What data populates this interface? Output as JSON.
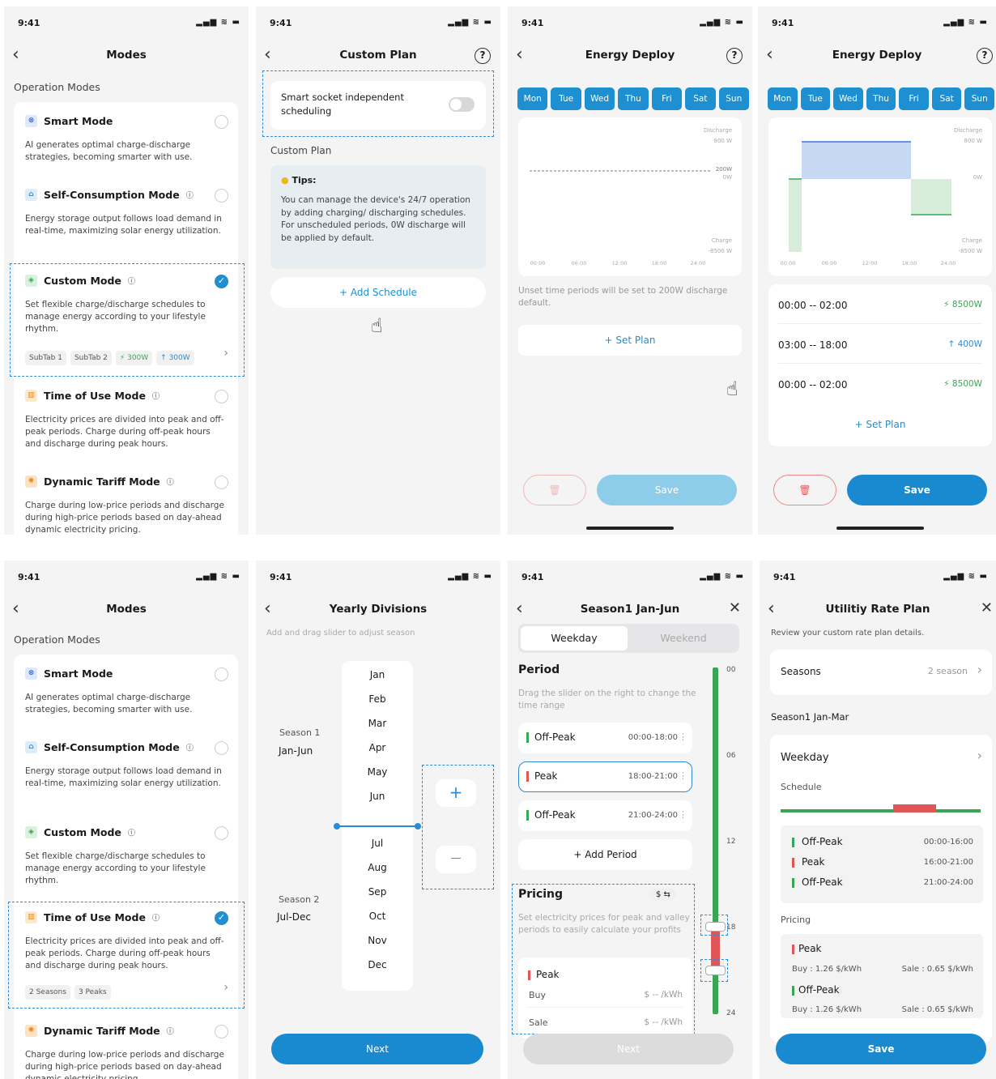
{
  "status": {
    "time": "9:41",
    "icons": "▂▄▆ ≋ ▬"
  },
  "icons": {
    "back": "‹",
    "close": "✕",
    "help": "?",
    "check": "✓",
    "bolt": "⚡",
    "up": "↑",
    "trash": "🗑",
    "hand": "☝",
    "plus": "+",
    "minus": "—",
    "more": "⋮",
    "chev": "›",
    "swap": "$ ⇆"
  },
  "colors": {
    "accent": "#1e8fd0",
    "green": "#3aa655",
    "red": "#e05656"
  },
  "modes": {
    "title": "Modes",
    "section": "Operation Modes",
    "smart": {
      "name": "Smart Mode",
      "desc": "AI generates optimal charge-discharge strategies, becoming smarter with use."
    },
    "self": {
      "name": "Self-Consumption Mode",
      "desc": "Energy storage output follows load demand in real-time, maximizing solar energy utilization."
    },
    "custom": {
      "name": "Custom Mode",
      "desc": "Set flexible charge/discharge schedules to manage energy according to your lifestyle rhythm.",
      "chips": [
        "SubTab 1",
        "SubTab 2",
        "⚡ 300W",
        "↑ 300W"
      ]
    },
    "tou": {
      "name": "Time of Use Mode",
      "desc": "Electricity prices are divided into peak and off-peak periods. Charge during off-peak hours and discharge during peak hours.",
      "chips": [
        "2 Seasons",
        "3 Peaks"
      ]
    },
    "dyn": {
      "name": "Dynamic Tariff Mode",
      "desc": "Charge during low-price periods and discharge during high-price periods based on day-ahead dynamic electricity pricing.",
      "desc2": "Charge during low-price periods and discharge during high-price periods based on day-ahead dynamic electricity pricing."
    }
  },
  "custom_plan": {
    "title": "Custom Plan",
    "toggle_label": "Smart socket independent scheduling",
    "section": "Custom Plan",
    "tips_title": "Tips:",
    "tips": "You can manage the device's 24/7 operation by adding charging/ discharging schedules. For unscheduled periods, 0W discharge will be applied by default.",
    "add": "+ Add Schedule"
  },
  "energy": {
    "title": "Energy Deploy",
    "days": [
      "Mon",
      "Tue",
      "Wed",
      "Thu",
      "Fri",
      "Sat",
      "Sun"
    ],
    "y_top": "Discharge",
    "y_top_val": "800 W",
    "y_mid": "200W",
    "y_zero": "0W",
    "y_bot": "Charge",
    "y_bot_val": "-8500 W",
    "xticks": [
      "00:00",
      "06:00",
      "12:00",
      "18:00",
      "24:00"
    ],
    "note": "Unset time periods will be set to 200W discharge default.",
    "set_plan": "+ Set Plan",
    "save": "Save",
    "plans": [
      {
        "range": "00:00 -- 02:00",
        "val": "⚡ 8500W"
      },
      {
        "range": "03:00 -- 18:00",
        "val": "↑ 400W"
      },
      {
        "range": "00:00 -- 02:00",
        "val": "⚡ 8500W"
      }
    ]
  },
  "chart_data": {
    "type": "area",
    "x": [
      "00:00",
      "06:00",
      "12:00",
      "18:00",
      "24:00"
    ],
    "series": [
      {
        "values": [
          -8500,
          800,
          800,
          -3000,
          0
        ]
      }
    ],
    "ylim": [
      -8500,
      800
    ]
  },
  "yearly": {
    "title": "Yearly Divisions",
    "hint": "Add and drag slider to adjust season",
    "months": [
      "Jan",
      "Feb",
      "Mar",
      "Apr",
      "May",
      "Jun",
      "Jul",
      "Aug",
      "Sep",
      "Oct",
      "Nov",
      "Dec"
    ],
    "s1": "Season 1",
    "s1r": "Jan-Jun",
    "s2": "Season 2",
    "s2r": "Jul-Dec",
    "next": "Next"
  },
  "season": {
    "title": "Season1 Jan-Jun",
    "tabs": [
      "Weekday",
      "Weekend"
    ],
    "period": "Period",
    "period_hint": "Drag the slider on the right to change the time range",
    "rows": [
      {
        "name": "Off-Peak",
        "time": "00:00-18:00"
      },
      {
        "name": "Peak",
        "time": "18:00-21:00"
      },
      {
        "name": "Off-Peak",
        "time": "21:00-24:00"
      }
    ],
    "add": "+ Add Period",
    "pricing": "Pricing",
    "price_hint": "Set electricity prices for peak and valley periods to easily calculate your profits",
    "peak": "Peak",
    "buy": "Buy",
    "sale": "Sale",
    "unit": "$ -- /kWh",
    "ticks": [
      "00",
      "06",
      "12",
      "18",
      "24"
    ],
    "next": "Next"
  },
  "utility": {
    "title": "Utilitiy Rate Plan",
    "hint": "Review your custom rate plan details.",
    "seasons": "Seasons",
    "seasons_val": "2 season",
    "sub": "Season1 Jan-Mar",
    "weekday": "Weekday",
    "schedule": "Schedule",
    "rows": [
      {
        "name": "Off-Peak",
        "time": "00:00-16:00"
      },
      {
        "name": "Peak",
        "time": "16:00-21:00"
      },
      {
        "name": "Off-Peak",
        "time": "21:00-24:00"
      }
    ],
    "pricing": "Pricing",
    "p1": "Peak",
    "p2": "Off-Peak",
    "buy": "Buy : 1.26 $/kWh",
    "sale": "Sale : 0.65 $/kWh",
    "save": "Save"
  }
}
